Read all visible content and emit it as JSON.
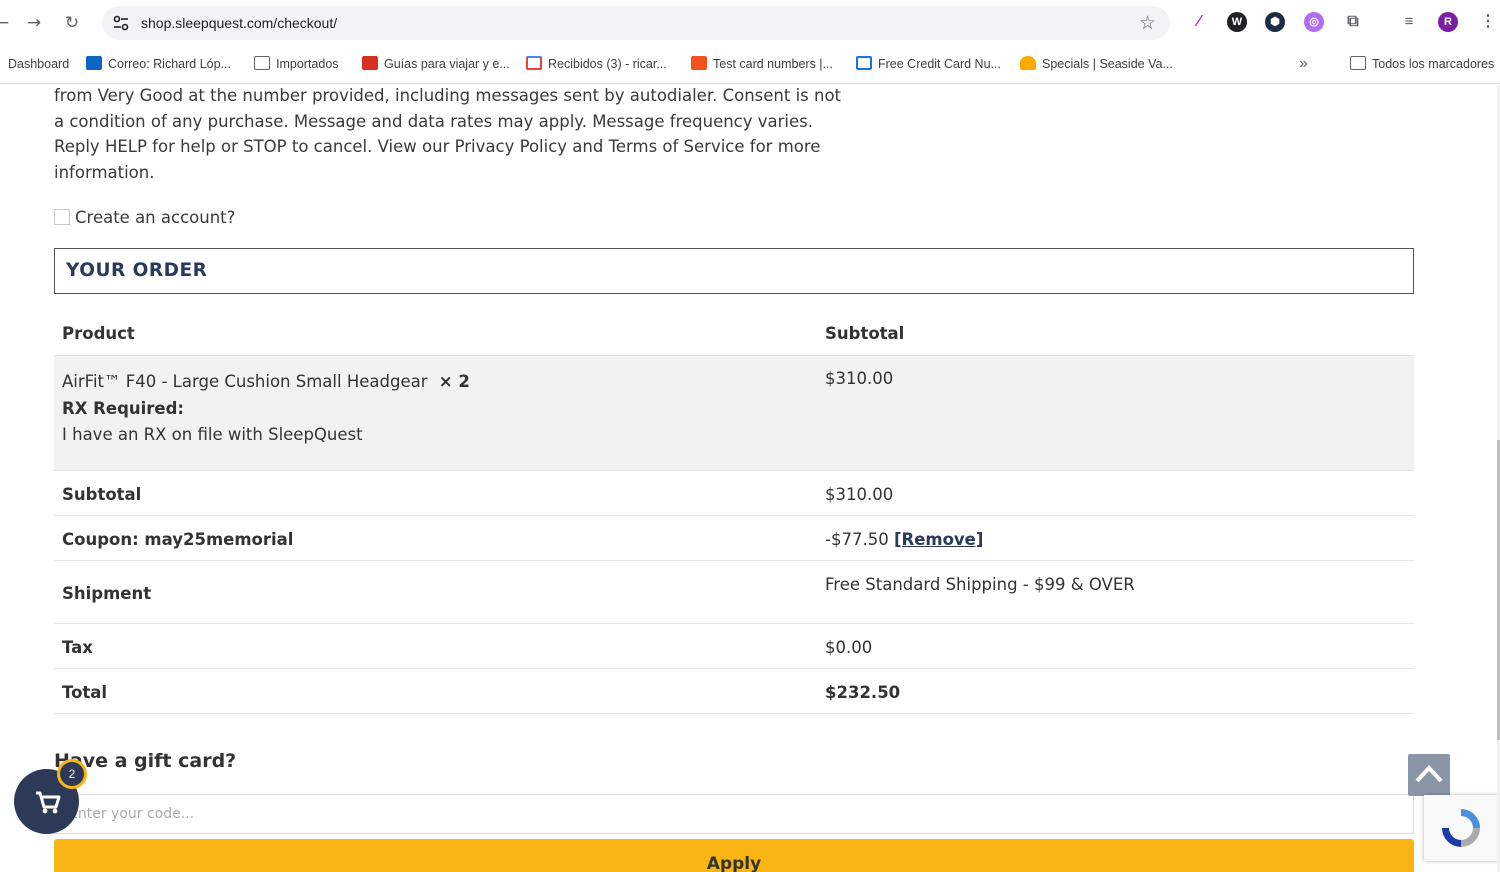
{
  "browser": {
    "url": "shop.sleepquest.com/checkout/",
    "profile_initial": "R",
    "bookmarks": [
      {
        "label": "Dashboard",
        "icon": "none",
        "color": "#ffffff"
      },
      {
        "label": "Correo: Richard Lóp...",
        "icon": "outlook-icon",
        "color": "#0a66c2"
      },
      {
        "label": "Importados",
        "icon": "folder-icon",
        "color": "#5f6368"
      },
      {
        "label": "Guías para viajar y e...",
        "icon": "travel-icon",
        "color": "#d93025"
      },
      {
        "label": "Recibidos (3) - ricar...",
        "icon": "gmail-icon",
        "color": "#ea4335"
      },
      {
        "label": "Test card numbers |...",
        "icon": "card-icon",
        "color": "#f4511e"
      },
      {
        "label": "Free Credit Card Nu...",
        "icon": "credit-card-icon",
        "color": "#1a73e8"
      },
      {
        "label": "Specials | Seaside Va...",
        "icon": "seaside-icon",
        "color": "#f9ab00"
      }
    ],
    "all_bookmarks": "Todos los marcadores"
  },
  "checkout": {
    "consent_text": "from Very Good at the number provided, including messages sent by autodialer. Consent is not a condition of any purchase. Message and data rates may apply. Message frequency varies. Reply HELP for help or STOP to cancel. View our Privacy Policy and Terms of Service for more information.",
    "create_account": "Create an account?",
    "your_order_title": "YOUR ORDER",
    "table": {
      "col_product": "Product",
      "col_subtotal": "Subtotal",
      "product_name": "AirFit™ F40 - Large Cushion Small Headgear",
      "product_qty": "× 2",
      "rx_label": "RX Required:",
      "rx_value": "I have an RX on file with SleepQuest",
      "product_price": "$310.00",
      "subtotal_label": "Subtotal",
      "subtotal_value": "$310.00",
      "coupon_label": "Coupon: may25memorial",
      "coupon_value": "-$77.50",
      "coupon_remove": "[Remove]",
      "shipment_label": "Shipment",
      "shipment_value": "Free Standard Shipping - $99 & OVER",
      "tax_label": "Tax",
      "tax_value": "$0.00",
      "total_label": "Total",
      "total_value": "$232.50"
    },
    "gift_title": "Have a gift card?",
    "gift_placeholder": "Enter your code...",
    "apply_label": "Apply",
    "cart_count": "2"
  },
  "colors": {
    "brand_navy": "#2d3a57",
    "accent_yellow": "#f9b513"
  }
}
